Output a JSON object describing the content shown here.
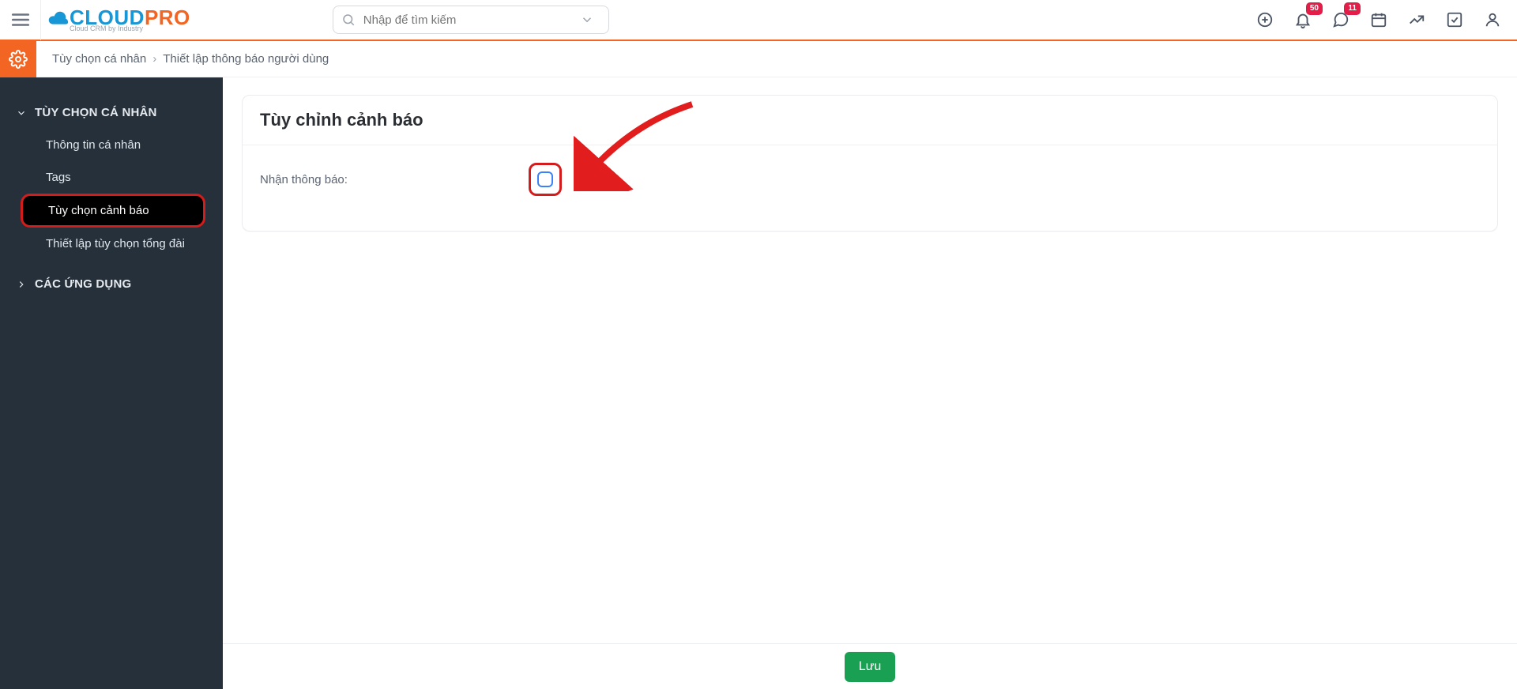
{
  "header": {
    "logo_cloud": "CLOUD",
    "logo_pro": "PRO",
    "logo_sub": "Cloud CRM by Industry",
    "search_placeholder": "Nhập để tìm kiếm",
    "badges": {
      "bell": "50",
      "chat": "11"
    }
  },
  "breadcrumb": {
    "a": "Tùy chọn cá nhân",
    "b": "Thiết lập thông báo người dùng"
  },
  "sidebar": {
    "group1": {
      "title": "TÙY CHỌN CÁ NHÂN",
      "items": [
        "Thông tin cá nhân",
        "Tags",
        "Tùy chọn cảnh báo",
        "Thiết lập tùy chọn tổng đài"
      ]
    },
    "group2": {
      "title": "CÁC ỨNG DỤNG"
    }
  },
  "panel": {
    "title": "Tùy chỉnh cảnh báo",
    "label": "Nhận thông báo:"
  },
  "footer": {
    "save": "Lưu"
  }
}
